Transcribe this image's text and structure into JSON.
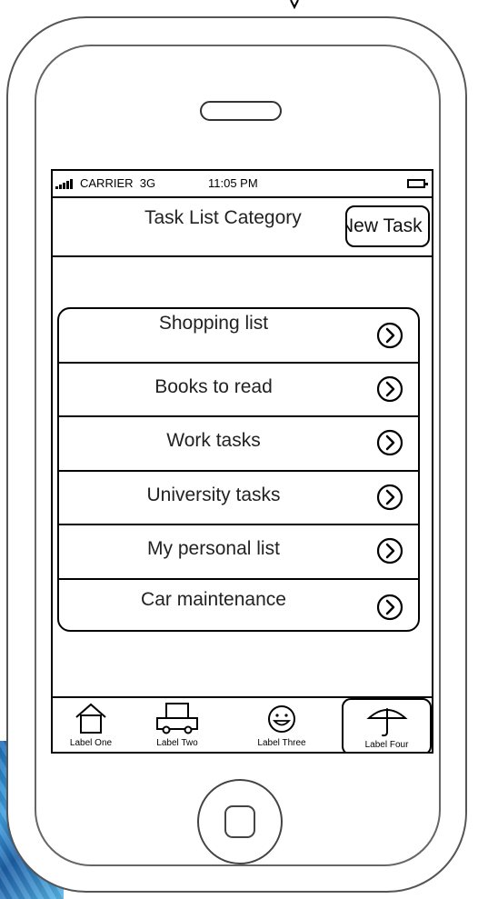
{
  "status_bar": {
    "carrier": "CARRIER",
    "network": "3G",
    "time": "11:05 PM"
  },
  "nav_bar": {
    "title": "Task List Category",
    "new_task_label": "New Task"
  },
  "task_list": {
    "items": [
      {
        "label": "Shopping list",
        "icon": "chevron-right-circle-icon"
      },
      {
        "label": "Books to read",
        "icon": "chevron-right-circle-icon"
      },
      {
        "label": "Work tasks",
        "icon": "chevron-right-circle-icon"
      },
      {
        "label": "University tasks",
        "icon": "chevron-right-circle-icon"
      },
      {
        "label": "My personal list",
        "icon": "chevron-right-circle-icon"
      },
      {
        "label": "Car maintenance",
        "icon": "chevron-right-circle-icon"
      }
    ]
  },
  "tab_bar": {
    "tabs": [
      {
        "label": "Label One",
        "icon": "house-icon"
      },
      {
        "label": "Label Two",
        "icon": "car-icon"
      },
      {
        "label": "Label Three",
        "icon": "smiley-icon"
      },
      {
        "label": "Label Four",
        "icon": "umbrella-icon",
        "selected": true
      }
    ]
  },
  "colors": {
    "stroke": "#000000",
    "background": "#ffffff",
    "accent_blue": "#1e6db5"
  }
}
